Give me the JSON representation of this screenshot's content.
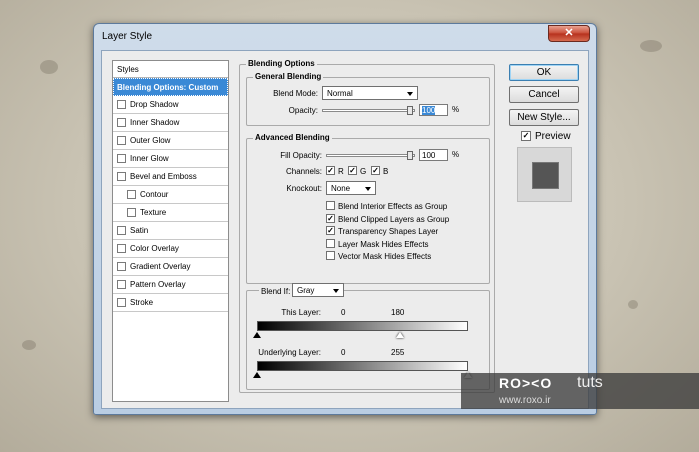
{
  "window": {
    "title": "Layer Style",
    "close_glyph": "✕"
  },
  "styles_panel": {
    "header": "Styles",
    "items": [
      {
        "label": "Blending Options: Custom",
        "selected": true,
        "has_checkbox": false,
        "indent": 0
      },
      {
        "label": "Drop Shadow",
        "has_checkbox": true,
        "checked": false,
        "indent": 0
      },
      {
        "label": "Inner Shadow",
        "has_checkbox": true,
        "checked": false,
        "indent": 0
      },
      {
        "label": "Outer Glow",
        "has_checkbox": true,
        "checked": false,
        "indent": 0
      },
      {
        "label": "Inner Glow",
        "has_checkbox": true,
        "checked": false,
        "indent": 0
      },
      {
        "label": "Bevel and Emboss",
        "has_checkbox": true,
        "checked": false,
        "indent": 0
      },
      {
        "label": "Contour",
        "has_checkbox": true,
        "checked": false,
        "indent": 1
      },
      {
        "label": "Texture",
        "has_checkbox": true,
        "checked": false,
        "indent": 1
      },
      {
        "label": "Satin",
        "has_checkbox": true,
        "checked": false,
        "indent": 0
      },
      {
        "label": "Color Overlay",
        "has_checkbox": true,
        "checked": false,
        "indent": 0
      },
      {
        "label": "Gradient Overlay",
        "has_checkbox": true,
        "checked": false,
        "indent": 0
      },
      {
        "label": "Pattern Overlay",
        "has_checkbox": true,
        "checked": false,
        "indent": 0
      },
      {
        "label": "Stroke",
        "has_checkbox": true,
        "checked": false,
        "indent": 0
      }
    ]
  },
  "blending_options": {
    "title": "Blending Options",
    "general": {
      "title": "General Blending",
      "blend_mode_label": "Blend Mode:",
      "blend_mode_value": "Normal",
      "opacity_label": "Opacity:",
      "opacity_value": "100",
      "percent": "%"
    },
    "advanced": {
      "title": "Advanced Blending",
      "fill_opacity_label": "Fill Opacity:",
      "fill_opacity_value": "100",
      "percent": "%",
      "channels_label": "Channels:",
      "channel_r": "R",
      "channel_g": "G",
      "channel_b": "B",
      "knockout_label": "Knockout:",
      "knockout_value": "None",
      "options": [
        {
          "label": "Blend Interior Effects as Group",
          "checked": false
        },
        {
          "label": "Blend Clipped Layers as Group",
          "checked": true
        },
        {
          "label": "Transparency Shapes Layer",
          "checked": true
        },
        {
          "label": "Layer Mask Hides Effects",
          "checked": false
        },
        {
          "label": "Vector Mask Hides Effects",
          "checked": false
        }
      ]
    },
    "blend_if": {
      "label": "Blend If:",
      "value": "Gray",
      "this_layer_label": "This Layer:",
      "this_layer_low": "0",
      "this_layer_high": "180",
      "underlying_label": "Underlying Layer:",
      "underlying_low": "0",
      "underlying_high": "255"
    }
  },
  "buttons": {
    "ok": "OK",
    "cancel": "Cancel",
    "new_style": "New Style...",
    "preview_label": "Preview",
    "preview_checked": true
  },
  "watermark": {
    "logo": "RO><O",
    "tuts": "tuts",
    "url": "www.roxo.ir"
  },
  "colors": {
    "selection": "#3a89d6",
    "title_bar": "#c2d4e8",
    "close": "#c84a35"
  }
}
